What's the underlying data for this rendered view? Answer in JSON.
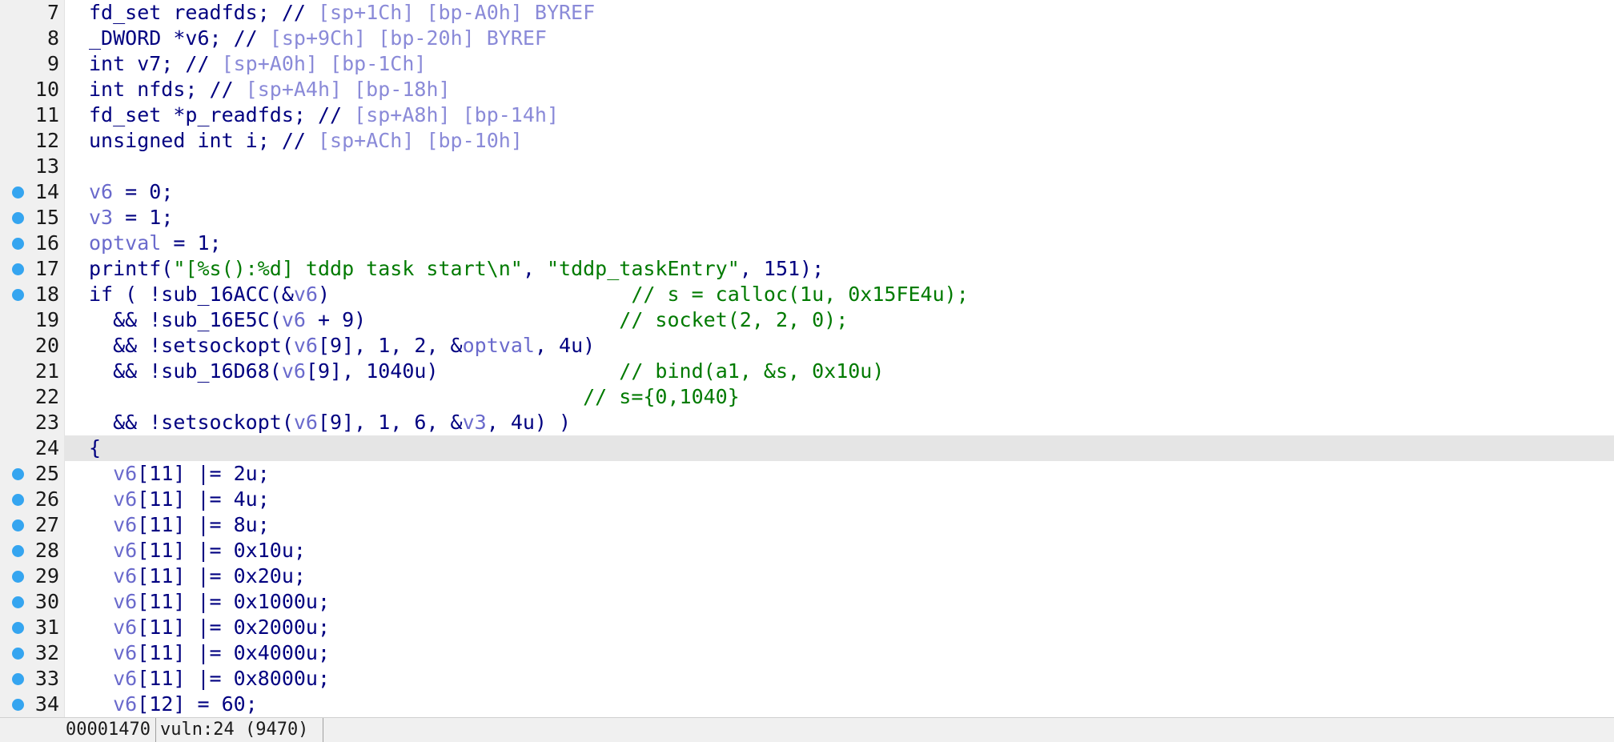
{
  "editor": {
    "highlighted_line": "24",
    "lines": [
      {
        "num": "7",
        "bp": false,
        "tokens": [
          {
            "t": "fd_set readfds; // ",
            "k": "t"
          },
          {
            "t": "[sp+1Ch] [bp-A0h] BYREF",
            "k": "g"
          }
        ]
      },
      {
        "num": "8",
        "bp": false,
        "tokens": [
          {
            "t": "_DWORD *",
            "k": "t"
          },
          {
            "t": "v6",
            "k": "t"
          },
          {
            "t": "; // ",
            "k": "t"
          },
          {
            "t": "[sp+9Ch] [bp-20h] BYREF",
            "k": "g"
          }
        ]
      },
      {
        "num": "9",
        "bp": false,
        "tokens": [
          {
            "t": "int v7; // ",
            "k": "t"
          },
          {
            "t": "[sp+A0h] [bp-1Ch]",
            "k": "g"
          }
        ]
      },
      {
        "num": "10",
        "bp": false,
        "tokens": [
          {
            "t": "int nfds; // ",
            "k": "t"
          },
          {
            "t": "[sp+A4h] [bp-18h]",
            "k": "g"
          }
        ]
      },
      {
        "num": "11",
        "bp": false,
        "tokens": [
          {
            "t": "fd_set *p_readfds; // ",
            "k": "t"
          },
          {
            "t": "[sp+A8h] [bp-14h]",
            "k": "g"
          }
        ]
      },
      {
        "num": "12",
        "bp": false,
        "tokens": [
          {
            "t": "unsigned int i; // ",
            "k": "t"
          },
          {
            "t": "[sp+ACh] [bp-10h]",
            "k": "g"
          }
        ]
      },
      {
        "num": "13",
        "bp": false,
        "tokens": []
      },
      {
        "num": "14",
        "bp": true,
        "tokens": [
          {
            "t": "v6",
            "k": "v"
          },
          {
            "t": " = 0;",
            "k": "t"
          }
        ]
      },
      {
        "num": "15",
        "bp": true,
        "tokens": [
          {
            "t": "v3",
            "k": "v"
          },
          {
            "t": " = 1;",
            "k": "t"
          }
        ]
      },
      {
        "num": "16",
        "bp": true,
        "tokens": [
          {
            "t": "optval",
            "k": "v"
          },
          {
            "t": " = 1;",
            "k": "t"
          }
        ]
      },
      {
        "num": "17",
        "bp": true,
        "tokens": [
          {
            "t": "printf(",
            "k": "t"
          },
          {
            "t": "\"[%s():%d] tddp task start\\n\"",
            "k": "s"
          },
          {
            "t": ", ",
            "k": "t"
          },
          {
            "t": "\"tddp_taskEntry\"",
            "k": "s"
          },
          {
            "t": ", 151);",
            "k": "t"
          }
        ]
      },
      {
        "num": "18",
        "bp": true,
        "tokens": [
          {
            "t": "if ( !sub_16ACC(&",
            "k": "t"
          },
          {
            "t": "v6",
            "k": "v"
          },
          {
            "t": ")                         ",
            "k": "t"
          },
          {
            "t": "// s = calloc(1u, 0x15FE4u);",
            "k": "c"
          }
        ]
      },
      {
        "num": "19",
        "bp": false,
        "tokens": [
          {
            "t": "  && !sub_16E5C(",
            "k": "t"
          },
          {
            "t": "v6",
            "k": "v"
          },
          {
            "t": " + 9)                     ",
            "k": "t"
          },
          {
            "t": "// socket(2, 2, 0);",
            "k": "c"
          }
        ]
      },
      {
        "num": "20",
        "bp": false,
        "tokens": [
          {
            "t": "  && !setsockopt(",
            "k": "t"
          },
          {
            "t": "v6",
            "k": "v"
          },
          {
            "t": "[9], 1, 2, &",
            "k": "t"
          },
          {
            "t": "optval",
            "k": "v"
          },
          {
            "t": ", 4u)",
            "k": "t"
          }
        ]
      },
      {
        "num": "21",
        "bp": false,
        "tokens": [
          {
            "t": "  && !sub_16D68(",
            "k": "t"
          },
          {
            "t": "v6",
            "k": "v"
          },
          {
            "t": "[9], 1040u)               ",
            "k": "t"
          },
          {
            "t": "// bind(a1, &s, 0x10u)",
            "k": "c"
          }
        ]
      },
      {
        "num": "22",
        "bp": false,
        "tokens": [
          {
            "t": "                                         ",
            "k": "t"
          },
          {
            "t": "// s={0,1040}",
            "k": "c"
          }
        ]
      },
      {
        "num": "23",
        "bp": false,
        "tokens": [
          {
            "t": "  && !setsockopt(",
            "k": "t"
          },
          {
            "t": "v6",
            "k": "v"
          },
          {
            "t": "[9], 1, 6, &",
            "k": "t"
          },
          {
            "t": "v3",
            "k": "v"
          },
          {
            "t": ", 4u) )",
            "k": "t"
          }
        ]
      },
      {
        "num": "24",
        "bp": false,
        "tokens": [
          {
            "t": "{",
            "k": "t"
          }
        ]
      },
      {
        "num": "25",
        "bp": true,
        "tokens": [
          {
            "t": "  ",
            "k": "t"
          },
          {
            "t": "v6",
            "k": "v"
          },
          {
            "t": "[11] |= 2u;",
            "k": "t"
          }
        ]
      },
      {
        "num": "26",
        "bp": true,
        "tokens": [
          {
            "t": "  ",
            "k": "t"
          },
          {
            "t": "v6",
            "k": "v"
          },
          {
            "t": "[11] |= 4u;",
            "k": "t"
          }
        ]
      },
      {
        "num": "27",
        "bp": true,
        "tokens": [
          {
            "t": "  ",
            "k": "t"
          },
          {
            "t": "v6",
            "k": "v"
          },
          {
            "t": "[11] |= 8u;",
            "k": "t"
          }
        ]
      },
      {
        "num": "28",
        "bp": true,
        "tokens": [
          {
            "t": "  ",
            "k": "t"
          },
          {
            "t": "v6",
            "k": "v"
          },
          {
            "t": "[11] |= 0x10u;",
            "k": "t"
          }
        ]
      },
      {
        "num": "29",
        "bp": true,
        "tokens": [
          {
            "t": "  ",
            "k": "t"
          },
          {
            "t": "v6",
            "k": "v"
          },
          {
            "t": "[11] |= 0x20u;",
            "k": "t"
          }
        ]
      },
      {
        "num": "30",
        "bp": true,
        "tokens": [
          {
            "t": "  ",
            "k": "t"
          },
          {
            "t": "v6",
            "k": "v"
          },
          {
            "t": "[11] |= 0x1000u;",
            "k": "t"
          }
        ]
      },
      {
        "num": "31",
        "bp": true,
        "tokens": [
          {
            "t": "  ",
            "k": "t"
          },
          {
            "t": "v6",
            "k": "v"
          },
          {
            "t": "[11] |= 0x2000u;",
            "k": "t"
          }
        ]
      },
      {
        "num": "32",
        "bp": true,
        "tokens": [
          {
            "t": "  ",
            "k": "t"
          },
          {
            "t": "v6",
            "k": "v"
          },
          {
            "t": "[11] |= 0x4000u;",
            "k": "t"
          }
        ]
      },
      {
        "num": "33",
        "bp": true,
        "tokens": [
          {
            "t": "  ",
            "k": "t"
          },
          {
            "t": "v6",
            "k": "v"
          },
          {
            "t": "[11] |= 0x8000u;",
            "k": "t"
          }
        ]
      },
      {
        "num": "34",
        "bp": true,
        "tokens": [
          {
            "t": "  ",
            "k": "t"
          },
          {
            "t": "v6",
            "k": "v"
          },
          {
            "t": "[12] = 60;",
            "k": "t"
          }
        ]
      }
    ]
  },
  "status_bar": {
    "address": "00001470",
    "location": "vuln:24 (9470)"
  },
  "colors": {
    "breakpoint": "#35a5f0",
    "keyword_text": "#000080",
    "variable": "#6a6acc",
    "stack_comment": "#8a8ad8",
    "comment_string": "#007a00",
    "highlight_row": "#e5e5e5"
  }
}
